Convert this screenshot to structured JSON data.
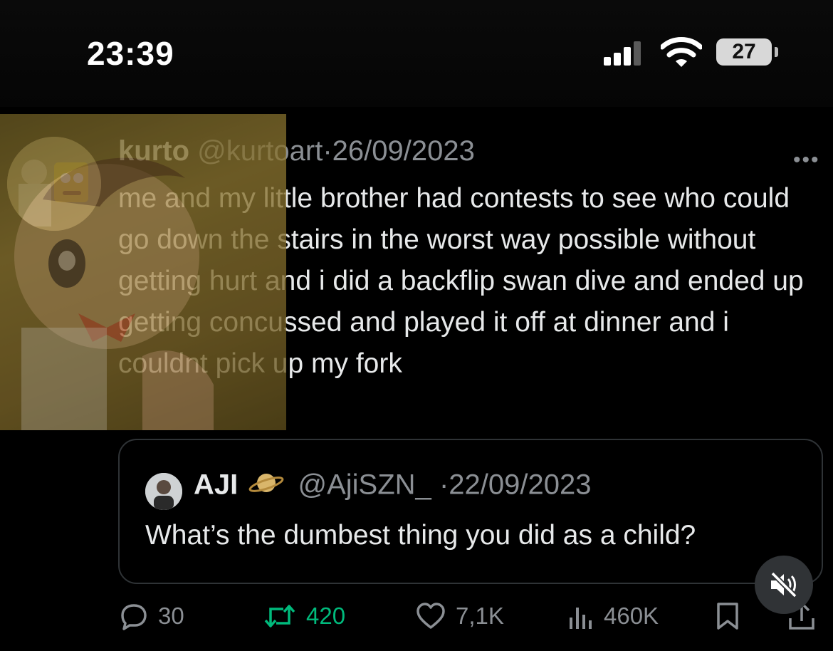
{
  "status_bar": {
    "time": "23:39",
    "battery": "27",
    "icons": [
      "signal-icon",
      "wifi-icon",
      "battery-icon"
    ]
  },
  "tweet": {
    "display_name": "kurto",
    "handle": "@kurtoart",
    "separator": "·",
    "date": "26/09/2023",
    "text": "me and my little brother had contests to see who could go down the stairs in the worst way possible without getting hurt and i did a backflip swan dive and ended up getting concussed and played it off at dinner and i couldnt pick up my fork",
    "quote": {
      "display_name": "AJI",
      "handle": "@AjiSZN_",
      "separator": "·",
      "date": "22/09/2023",
      "text": "What’s the dumbest thing you did as a child?"
    },
    "actions": {
      "replies": "30",
      "retweets": "420",
      "likes": "7,1K",
      "views": "460K"
    }
  },
  "colors": {
    "background": "#000000",
    "text": "#e7e9ea",
    "secondary": "#8b8f94",
    "retweet": "#00ba7c",
    "border": "#2f3336"
  }
}
